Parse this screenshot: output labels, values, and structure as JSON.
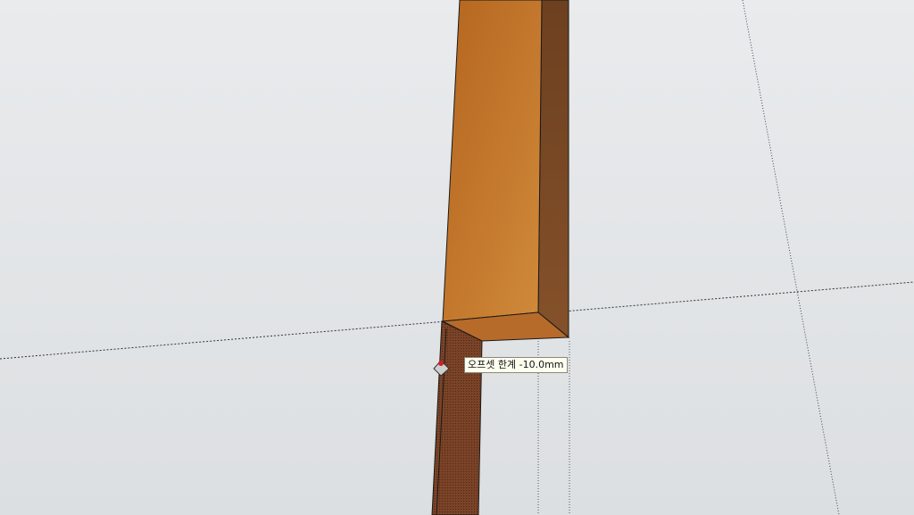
{
  "viewport": {
    "tool": "offset-tool",
    "cursor_icon": "offset-cursor-icon",
    "colors": {
      "sky": "#e9ebed",
      "ground": "#dcdfe1",
      "wood_front": "#b5651f",
      "wood_side": "#7d4a22",
      "wood_top": "#b76b2a",
      "inner_face": "#6e3c22",
      "edge": "#1a1a1a",
      "cursor_marker": "#d22020"
    }
  },
  "tooltip": {
    "label": "오프셋 한계",
    "value": "-10.0mm"
  }
}
